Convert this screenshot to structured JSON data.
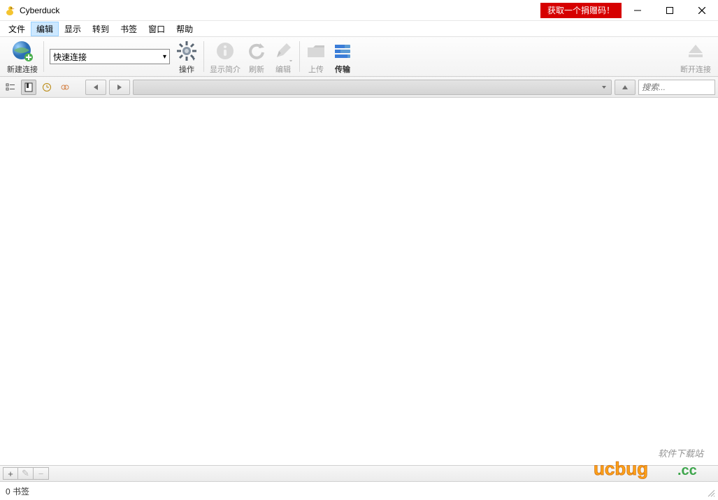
{
  "titlebar": {
    "app_name": "Cyberduck",
    "donate_label": "获取一个捐赠码！"
  },
  "menu": {
    "file": "文件",
    "edit": "编辑",
    "view": "显示",
    "go": "转到",
    "bookmark": "书签",
    "window": "窗口",
    "help": "帮助"
  },
  "toolbar": {
    "new_connection": "新建连接",
    "quick_connect_value": "快速连接",
    "action": "操作",
    "get_info": "显示简介",
    "refresh": "刷新",
    "edit": "编辑",
    "upload": "上传",
    "transfers": "传输",
    "disconnect": "断开连接"
  },
  "navbar": {
    "search_placeholder": "搜索..."
  },
  "bottombar": {
    "add": "+",
    "edit": "✎",
    "remove": "−"
  },
  "status": {
    "text": "0 书签"
  },
  "watermark": {
    "tagline": "软件下载站",
    "brand": "ucbug.cc"
  }
}
